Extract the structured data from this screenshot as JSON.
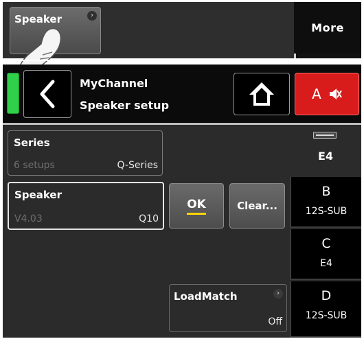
{
  "top": {
    "speaker_button": "Speaker",
    "more_button": "More"
  },
  "header": {
    "title": "MyChannel",
    "subtitle": "Speaker setup",
    "mute_channel": "A"
  },
  "fields": {
    "series": {
      "label": "Series",
      "sub": "6 setups",
      "value": "Q-Series"
    },
    "speaker": {
      "label": "Speaker",
      "sub": "V4.03",
      "value": "Q10"
    }
  },
  "buttons": {
    "ok": "OK",
    "clear": "Clear..."
  },
  "loadmatch": {
    "label": "LoadMatch",
    "value": "Off"
  },
  "channels": {
    "current": "E4",
    "tabs": [
      {
        "letter": "B",
        "model": "12S-SUB"
      },
      {
        "letter": "C",
        "model": "E4"
      },
      {
        "letter": "D",
        "model": "12S-SUB"
      }
    ]
  },
  "colors": {
    "status_led": "#2fd14a",
    "mute_active": "#d81b1b",
    "ok_underline": "#ffd400"
  },
  "icons": {
    "back": "chevron-left-icon",
    "home": "home-icon",
    "mute": "speaker-mute-icon",
    "more": "chevron-right-icon"
  }
}
